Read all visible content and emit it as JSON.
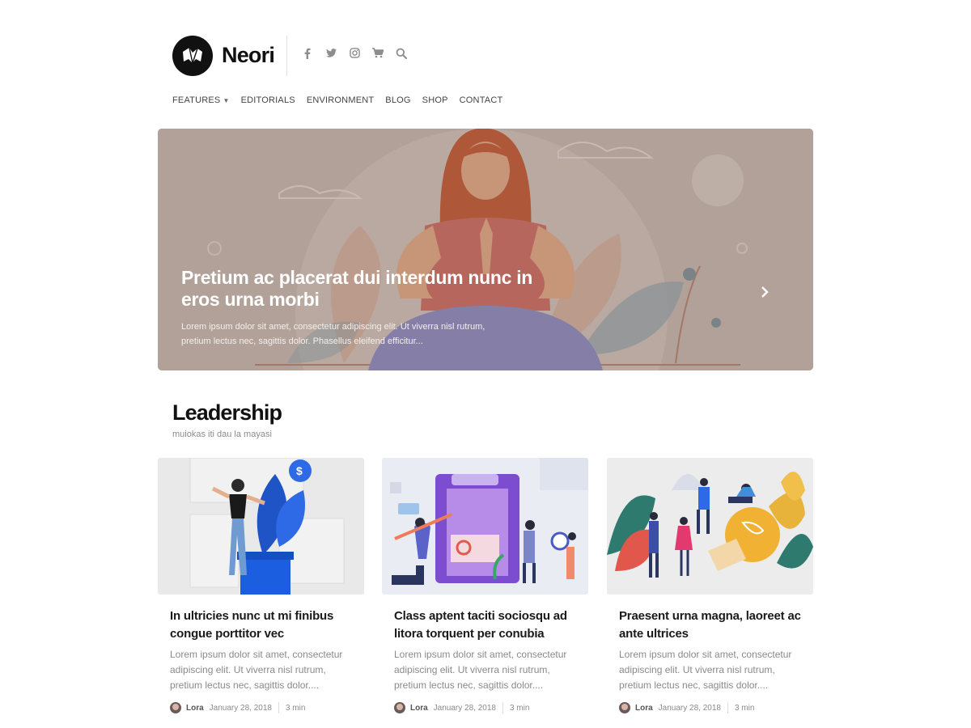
{
  "brand": {
    "name": "Neori"
  },
  "social_icons": [
    "facebook-icon",
    "twitter-icon",
    "instagram-icon",
    "cart-icon",
    "search-icon"
  ],
  "nav": {
    "items": [
      {
        "label": "FEATURES",
        "has_dropdown": true
      },
      {
        "label": "EDITORIALS"
      },
      {
        "label": "ENVIRONMENT"
      },
      {
        "label": "BLOG"
      },
      {
        "label": "SHOP"
      },
      {
        "label": "CONTACT"
      }
    ]
  },
  "hero": {
    "title": "Pretium ac placerat dui interdum nunc in eros urna morbi",
    "excerpt": "Lorem ipsum dolor sit amet, consectetur adipiscing elit. Ut viverra nisl rutrum, pretium lectus nec, sagittis dolor. Phasellus eleifend efficitur...",
    "next_icon": "chevron-right-icon"
  },
  "section": {
    "title": "Leadership",
    "subtitle": "muiokas iti dau la mayasi"
  },
  "cards": [
    {
      "title": "In ultricies nunc ut mi finibus congue porttitor vec",
      "excerpt": "Lorem ipsum dolor sit amet, consectetur adipiscing elit. Ut viverra nisl rutrum, pretium lectus nec, sagittis dolor....",
      "author": "Lora",
      "date": "January 28, 2018",
      "read_time": "3 min"
    },
    {
      "title": "Class aptent taciti sociosqu ad litora torquent per conubia",
      "excerpt": "Lorem ipsum dolor sit amet, consectetur adipiscing elit. Ut viverra nisl rutrum, pretium lectus nec, sagittis dolor....",
      "author": "Lora",
      "date": "January 28, 2018",
      "read_time": "3 min"
    },
    {
      "title": "Praesent urna magna, laoreet ac ante ultrices",
      "excerpt": "Lorem ipsum dolor sit amet, consectetur adipiscing elit. Ut viverra nisl rutrum, pretium lectus nec, sagittis dolor....",
      "author": "Lora",
      "date": "January 28, 2018",
      "read_time": "3 min"
    }
  ]
}
